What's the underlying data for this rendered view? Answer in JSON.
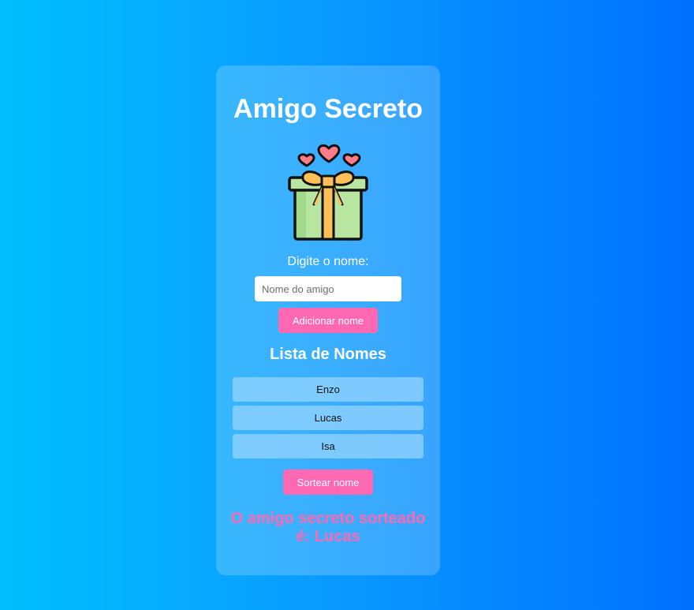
{
  "app": {
    "title": "Amigo Secreto"
  },
  "form": {
    "prompt_label": "Digite o nome:",
    "input_placeholder": "Nome do amigo",
    "input_value": "",
    "add_button_label": "Adicionar nome"
  },
  "list": {
    "heading": "Lista de Nomes",
    "names": [
      "Enzo",
      "Lucas",
      "Isa"
    ]
  },
  "draw": {
    "button_label": "Sortear nome",
    "result_text": "O amigo secreto sorteado é: Lucas"
  },
  "icons": {
    "illustration": "gift-with-hearts-icon"
  },
  "colors": {
    "accent": "#ff69b4",
    "background_start": "#00bfff",
    "background_end": "#0070ff"
  }
}
